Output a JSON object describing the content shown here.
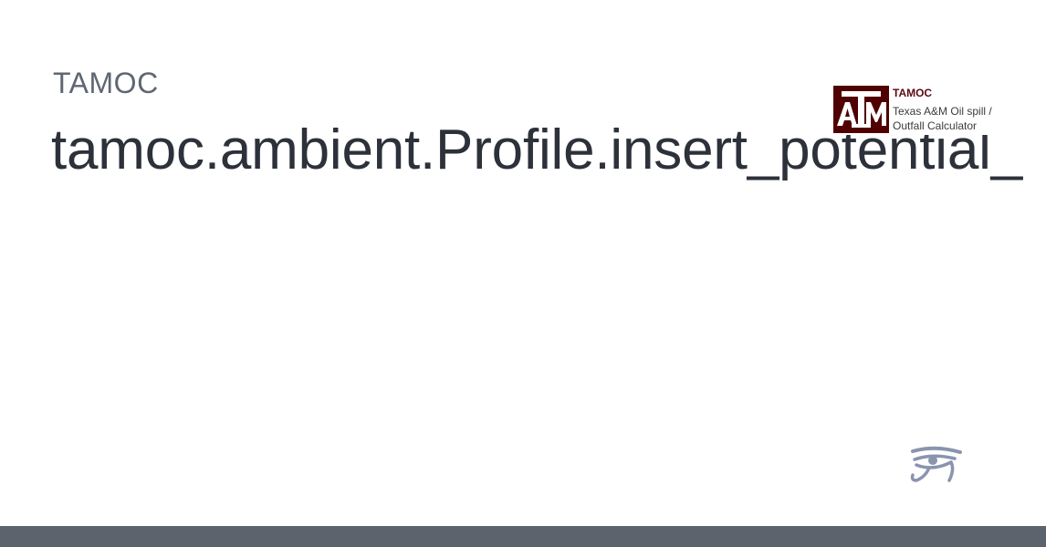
{
  "site": {
    "name": "TAMOC"
  },
  "page": {
    "title": "tamoc.ambient.Profile.insert_potential_"
  },
  "logo": {
    "mark_text": "ATM",
    "title": "TAMOC",
    "subtitle_line1": "Texas A&M Oil spill /",
    "subtitle_line2": "Outfall Calculator",
    "brand_color": "#500000"
  },
  "icons": {
    "bottom_right": "eye-of-horus-icon"
  },
  "colors": {
    "footer": "#5c636d",
    "title": "#2c313a",
    "site_name": "#5f6773",
    "eye_icon": "#8a94ae"
  }
}
